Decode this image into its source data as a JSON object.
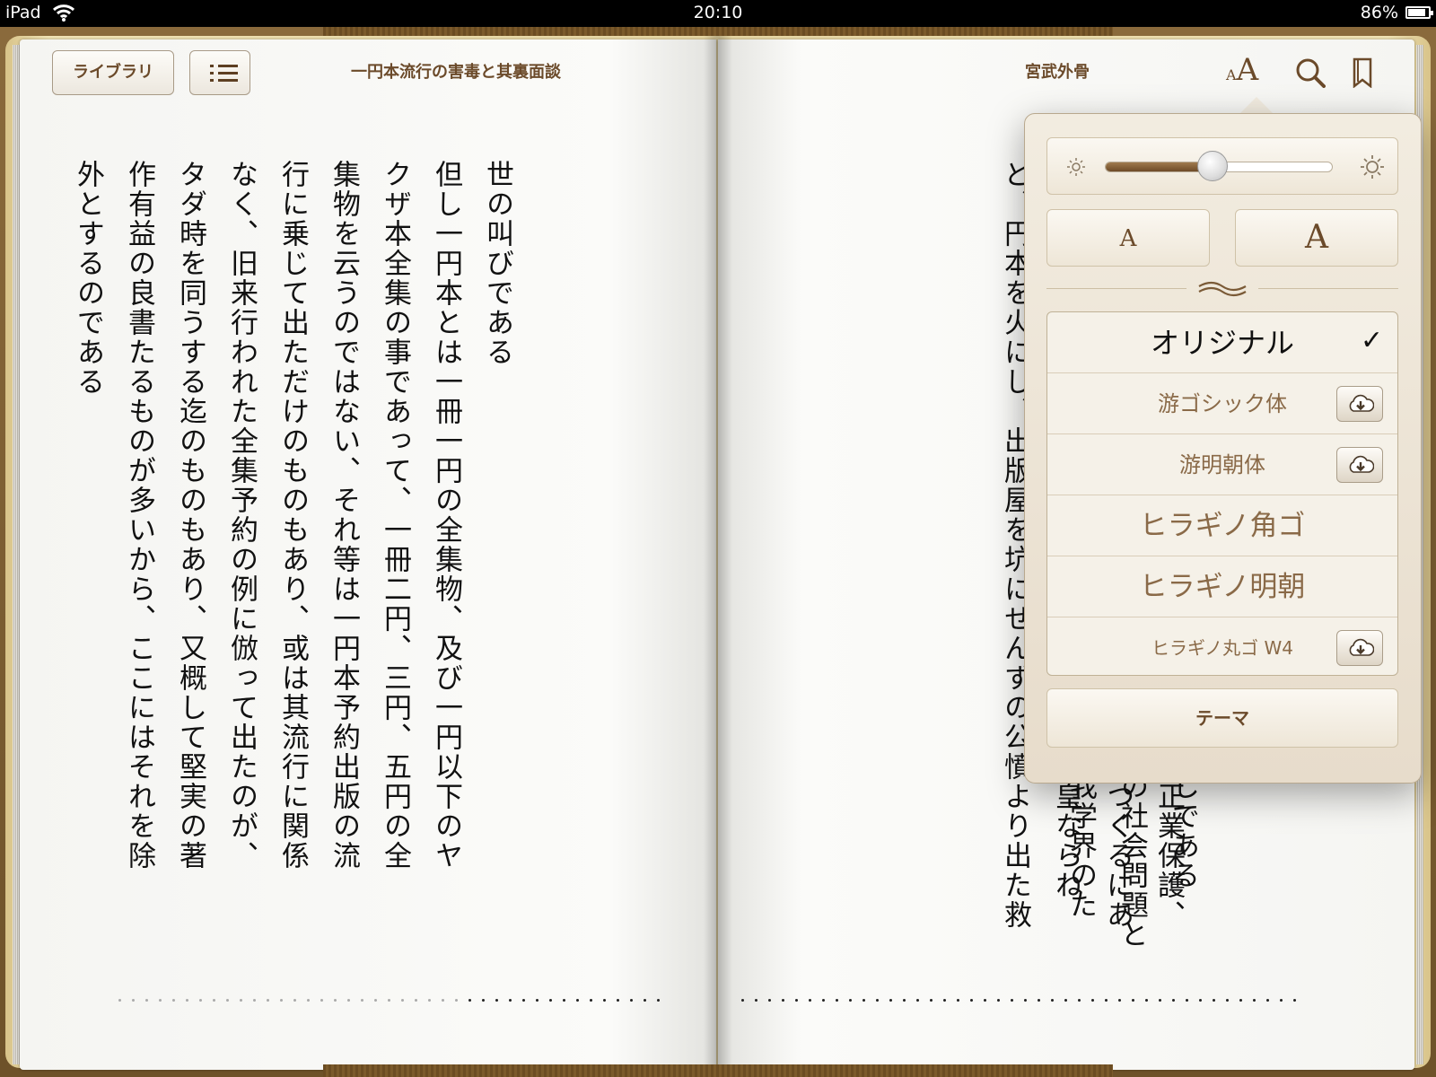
{
  "status_bar": {
    "device": "iPad",
    "time": "20:10",
    "battery": "86%",
    "battery_level": 0.86
  },
  "toolbar": {
    "library_label": "ライブラリ",
    "book_title": "一円本流行の害毒と其裏面談",
    "author": "宮武外骨"
  },
  "left_page": {
    "columns": [
      "世の叫びである",
      "但し一円本とは一冊一円の全集物、及び一円以下のヤ",
      "クザ本全集の事であって、一冊二円、三円、五円の全",
      "集物を云うのではない、それ等は一円本予約出版の流",
      "行に乗じて出ただけのものもあり、或は其流行に関係",
      "なく、旧来行われた全集予約の例に倣って出たのが、",
      "タダ時を同うする迄のものもあり、又概して堅実の著",
      "作有益の良書たるものが多いから、ここにはそれを除",
      "外とするのである"
    ]
  },
  "right_page": {
    "columns": [
      "要は破壊にあらずして建設、悪物退治にありて正業保護、",
      "罵らんとして罵るにあらず、傷つけんとして傷つくるにあ",
      "らず、正論硬議、熱血の迸り、熱涙の滴り、秦皇ならね",
      "ど、円本を火にし、出版屋を坑にせんずの公憤より出た救"
    ],
    "partial_columns": [
      "しである",
      "の社会問題と",
      "我学界のた"
    ]
  },
  "popover": {
    "brightness_level": 0.47,
    "size_small": "A",
    "size_large": "A",
    "fonts": [
      {
        "name": "オリジナル",
        "selected": true,
        "downloadable": false
      },
      {
        "name": "游ゴシック体",
        "selected": false,
        "downloadable": true
      },
      {
        "name": "游明朝体",
        "selected": false,
        "downloadable": true
      },
      {
        "name": "ヒラギノ角ゴ",
        "selected": false,
        "downloadable": false
      },
      {
        "name": "ヒラギノ明朝",
        "selected": false,
        "downloadable": false
      },
      {
        "name": "ヒラギノ丸ゴ W4",
        "selected": false,
        "downloadable": true
      }
    ],
    "checkmark": "✓",
    "theme_label": "テーマ"
  }
}
